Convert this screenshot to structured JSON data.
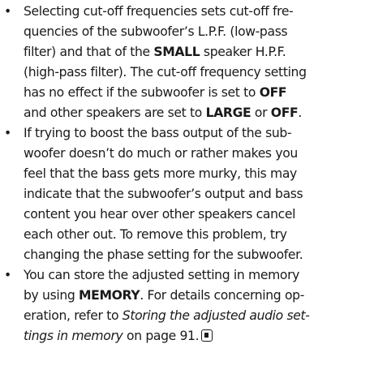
{
  "bullet_symbol": "•",
  "bullets": [
    {
      "lines": [
        [
          "Selecting cut-off frequencies sets cut-off fre-"
        ],
        [
          "quencies of the subwoofer’s L.P.F. (low-pass"
        ],
        [
          "filter) and that of the ",
          "SMALL",
          " speaker H.P.F."
        ],
        [
          "(high-pass filter). The cut-off frequency setting"
        ],
        [
          "has no effect if the subwoofer is set to ",
          "OFF"
        ],
        [
          "and other speakers are set to ",
          "LARGE",
          " or ",
          "OFF",
          "."
        ]
      ]
    },
    {
      "lines": [
        [
          "If trying to boost the bass output of the sub-"
        ],
        [
          "woofer doesn’t do much or rather makes you"
        ],
        [
          "feel that the bass gets more murky, this may"
        ],
        [
          "indicate that the subwoofer’s output and bass"
        ],
        [
          "content you hear over other speakers cancel"
        ],
        [
          "each other out. To remove this problem, try"
        ],
        [
          "changing the phase setting for the subwoofer."
        ]
      ]
    },
    {
      "lines": [
        [
          "You can store the adjusted setting in memory"
        ],
        [
          "by using ",
          "MEMORY",
          ". For details concerning op-"
        ],
        [
          "eration, refer to ",
          "Storing the adjusted audio set-"
        ],
        [
          "tings in memory",
          " on page 91."
        ]
      ]
    }
  ]
}
